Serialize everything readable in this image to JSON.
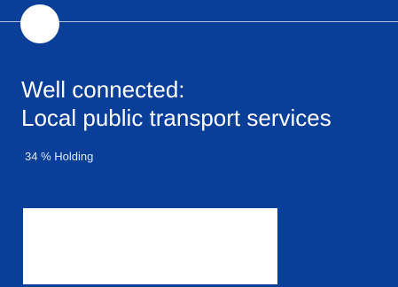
{
  "title": {
    "line1": "Well connected:",
    "line2": "Local public transport services"
  },
  "holding_text": "34 % Holding",
  "colors": {
    "background": "#0a3f99",
    "text": "#ffffff",
    "panel": "#ffffff"
  }
}
